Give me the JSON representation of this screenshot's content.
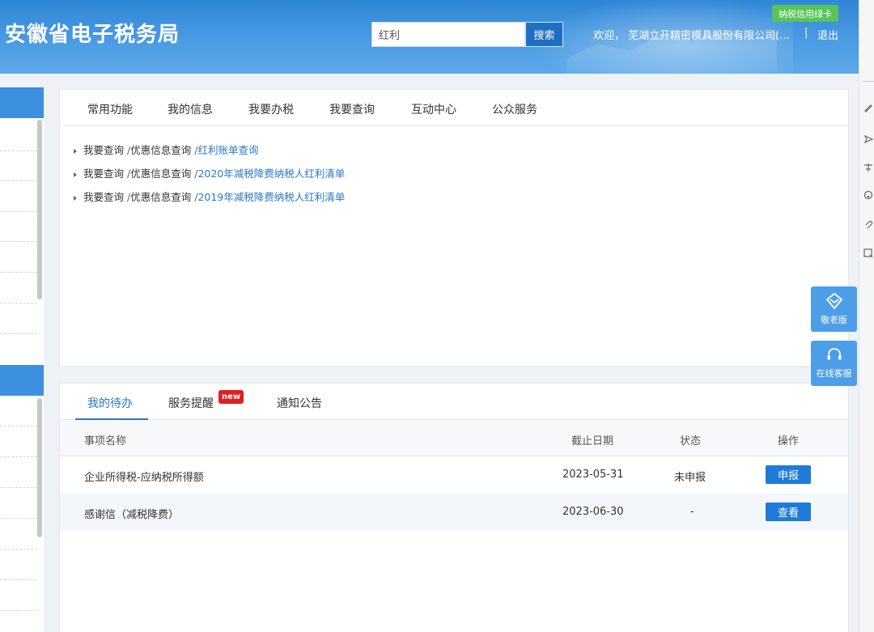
{
  "header": {
    "site_title": "安徽省电子税务局",
    "search_value": "红利",
    "search_button": "搜索",
    "welcome_text": "欢迎， 芜湖立开精密模具股份有限公司(...",
    "separator": "|",
    "logout": "退出",
    "green_card": "纳税信用绿卡"
  },
  "nav": {
    "items": [
      "常用功能",
      "我的信息",
      "我要办税",
      "我要查询",
      "互动中心",
      "公众服务"
    ]
  },
  "breadcrumbs": [
    {
      "part1": "我要查询",
      "part2": "优惠信息查询",
      "link": "红利账单查询"
    },
    {
      "part1": "我要查询",
      "part2": "优惠信息查询",
      "link": "2020年减税降费纳税人红利清单"
    },
    {
      "part1": "我要查询",
      "part2": "优惠信息查询",
      "link": "2019年减税降费纳税人红利清单"
    }
  ],
  "crumb_sep": "/",
  "tabs": {
    "items": [
      "我的待办",
      "服务提醒",
      "通知公告"
    ],
    "new_badge": "new"
  },
  "table": {
    "headers": [
      "事项名称",
      "截止日期",
      "状态",
      "操作"
    ],
    "rows": [
      {
        "name": "企业所得税-应纳税所得额",
        "deadline": "2023-05-31",
        "status": "未申报",
        "action": "申报"
      },
      {
        "name": "感谢信（减税降费）",
        "deadline": "2023-06-30",
        "status": "-",
        "action": "查看"
      }
    ]
  },
  "floating": {
    "elder_mode": "敬老版",
    "online_service": "在线客服"
  },
  "colors": {
    "header_blue": "#3a8fde",
    "link_blue": "#2a78c6",
    "button_blue": "#1e7bd8",
    "badge_red": "#e02020",
    "green_card": "#58c35a"
  }
}
